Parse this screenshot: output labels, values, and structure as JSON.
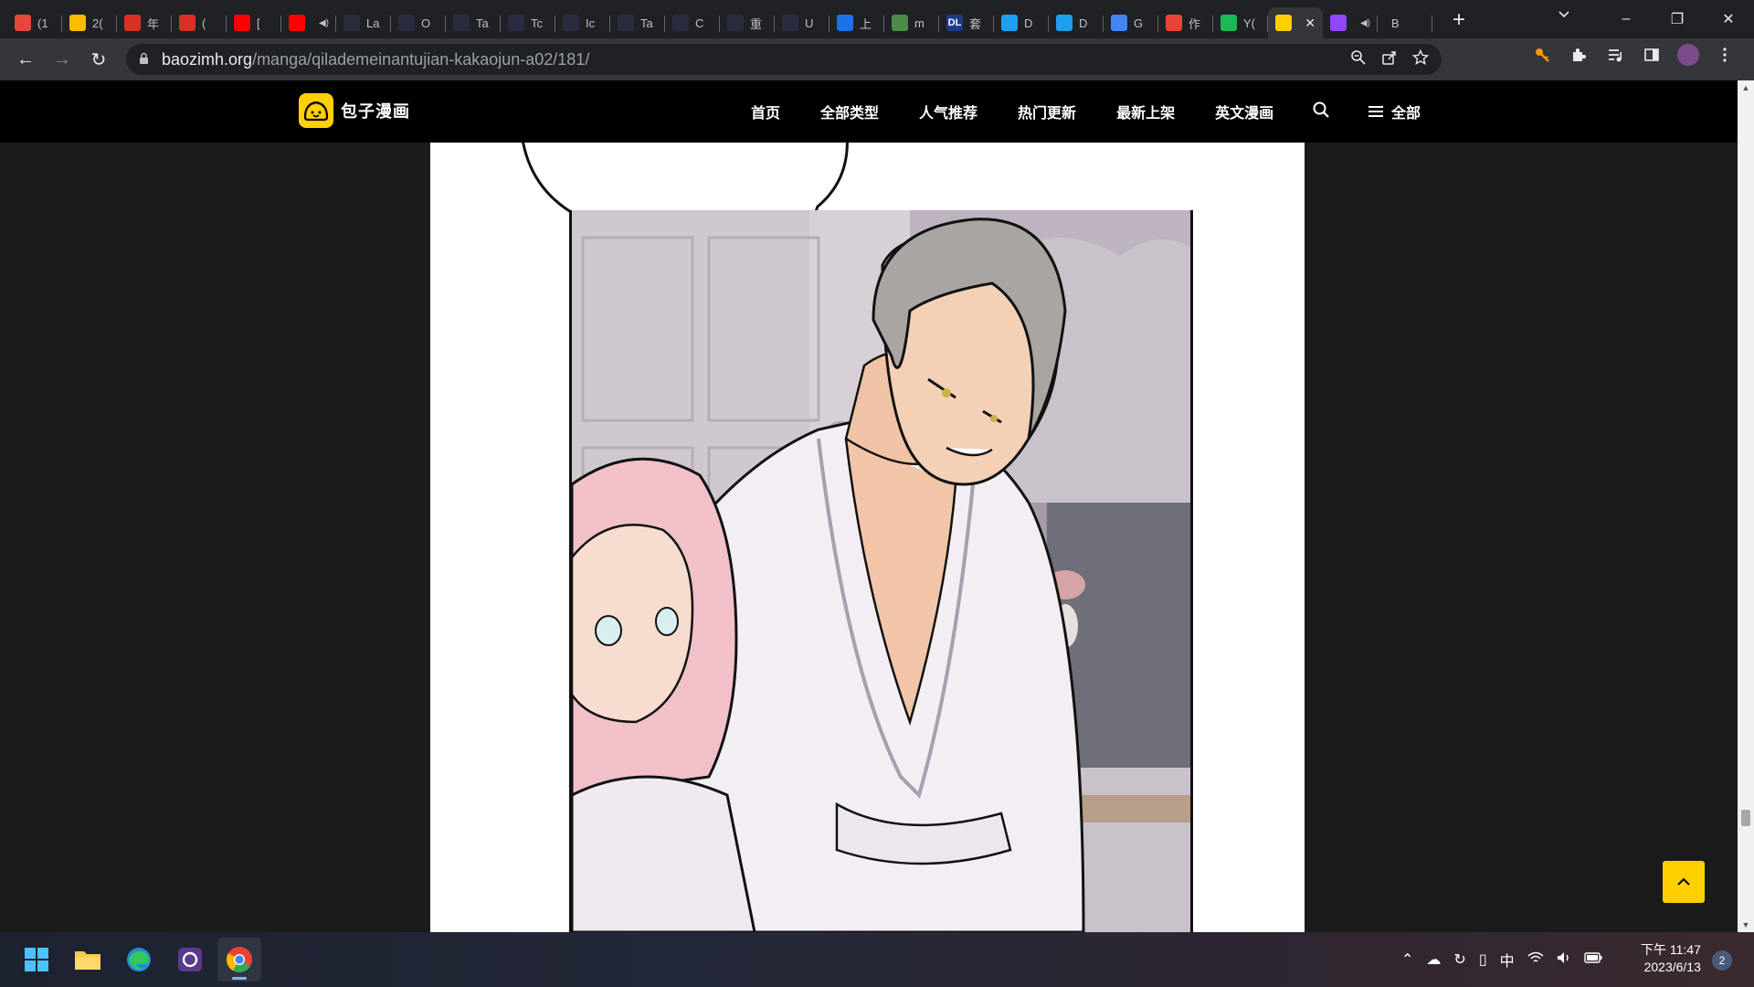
{
  "browser": {
    "tabs": [
      {
        "title": "(1",
        "icon": "round-red-icon",
        "color": "#e8453c"
      },
      {
        "title": "2(",
        "icon": "google-drive-icon",
        "color": "#fbbc04"
      },
      {
        "title": "年",
        "icon": "red-seal-icon",
        "color": "#d93025"
      },
      {
        "title": "(",
        "icon": "red-seal-icon",
        "color": "#d93025"
      },
      {
        "title": "[",
        "icon": "youtube-icon",
        "color": "#ff0000"
      },
      {
        "title": "",
        "icon": "youtube-icon",
        "color": "#ff0000",
        "audio": true
      },
      {
        "title": "La",
        "icon": "n-logo-icon",
        "color": "#2b2b40"
      },
      {
        "title": "O",
        "icon": "n-logo-icon",
        "color": "#2b2b40"
      },
      {
        "title": "Ta",
        "icon": "n-logo-icon",
        "color": "#2b2b40"
      },
      {
        "title": "Tc",
        "icon": "n-logo-icon",
        "color": "#2b2b40"
      },
      {
        "title": "Ic",
        "icon": "n-logo-icon",
        "color": "#2b2b40"
      },
      {
        "title": "Ta",
        "icon": "n-logo-icon",
        "color": "#2b2b40"
      },
      {
        "title": "C",
        "icon": "n-logo-icon",
        "color": "#2b2b40"
      },
      {
        "title": "重",
        "icon": "n-logo-icon",
        "color": "#2b2b40"
      },
      {
        "title": "U",
        "icon": "n-logo-icon",
        "color": "#2b2b40"
      },
      {
        "title": "上",
        "icon": "blue-s-icon",
        "color": "#1a73e8"
      },
      {
        "title": "m",
        "icon": "green-creature-icon",
        "color": "#4c8c4a"
      },
      {
        "title": "套",
        "icon": "dl-icon",
        "color": "#1a3b8c",
        "label": "DL"
      },
      {
        "title": "D",
        "icon": "blue-d-icon",
        "color": "#1ea0f0"
      },
      {
        "title": "D",
        "icon": "blue-d-icon",
        "color": "#1ea0f0"
      },
      {
        "title": "G",
        "icon": "google-translate-icon",
        "color": "#4285f4"
      },
      {
        "title": "作",
        "icon": "colorful-triangle-icon",
        "color": "#ea4335"
      },
      {
        "title": "Y(",
        "icon": "green-box-icon",
        "color": "#1db954"
      },
      {
        "title": "",
        "icon": "baozi-icon",
        "color": "#ffd000",
        "active": true
      },
      {
        "title": "",
        "icon": "twitch-icon",
        "color": "#9146ff",
        "audio": true
      },
      {
        "title": "B",
        "icon": "",
        "color": ""
      }
    ],
    "url": {
      "host": "baozimh.org",
      "path": "/manga/qilademeinantujian-kakaojun-a02/181/"
    }
  },
  "site": {
    "logo_text": "包子漫画",
    "nav": [
      "首页",
      "全部类型",
      "人气推荐",
      "热门更新",
      "最新上架",
      "英文漫画"
    ],
    "menu_label": "全部"
  },
  "taskbar": {
    "time": "下午 11:47",
    "date": "2023/6/13",
    "ime": "中",
    "notifications": "2"
  }
}
